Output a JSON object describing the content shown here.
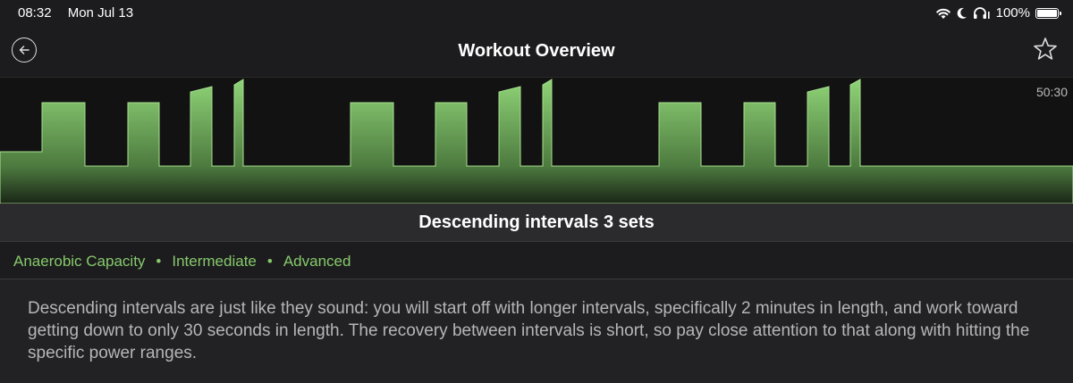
{
  "status_bar": {
    "time": "08:32",
    "date": "Mon Jul 13",
    "battery": "100%",
    "battery_level": 1.0,
    "icons": [
      "wifi-icon",
      "moon-icon",
      "headphones-icon",
      "battery-icon"
    ]
  },
  "nav": {
    "title": "Workout Overview",
    "back_icon": "back-arrow-icon",
    "favorite_icon": "star-icon"
  },
  "workout_graph": {
    "duration": "50:30",
    "accent_color": "#7cc868"
  },
  "workout": {
    "title": "Descending intervals 3 sets",
    "tags": [
      "Anaerobic Capacity",
      "Intermediate",
      "Advanced"
    ],
    "tag_color": "#86c96a",
    "description": "Descending intervals are just like they sound: you will start off with longer intervals, specifically 2 minutes in length, and work toward getting down to only 30 seconds in length. The recovery between intervals is short, so pay close attention to that along with hitting the specific power ranges."
  }
}
